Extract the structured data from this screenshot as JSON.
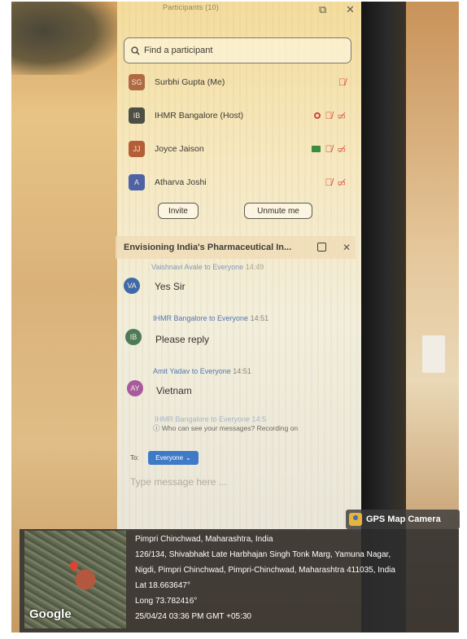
{
  "participants_panel": {
    "title": "Participants (10)",
    "search_placeholder": "Find a participant",
    "participants": [
      {
        "initials": "SG",
        "name": "Surbhi Gupta (Me)",
        "color": "#b06a43"
      },
      {
        "initials": "IB",
        "name": "IHMR Bangalore (Host)",
        "color": "#4b4f45"
      },
      {
        "initials": "JJ",
        "name": "Joyce Jaison",
        "color": "#b55d36"
      },
      {
        "initials": "A",
        "name": "Atharva Joshi",
        "color": "#4d63a6"
      }
    ],
    "invite_label": "Invite",
    "unmute_label": "Unmute me"
  },
  "chat_panel": {
    "title": "Envisioning India's Pharmaceutical In...",
    "messages": [
      {
        "sender": "Vaishnavi Avale to Everyone",
        "time": "14:49",
        "initials": "VA",
        "color": "#3f6aa8",
        "text": "Yes Sir"
      },
      {
        "sender": "IHMR Bangalore to Everyone",
        "time": "14:51",
        "initials": "IB",
        "color": "#4e7a5a",
        "text": "Please reply"
      },
      {
        "sender": "Amit Yadav to Everyone",
        "time": "14:51",
        "initials": "AY",
        "color": "#a85a9e",
        "text": "Vietnam"
      }
    ],
    "partial_sender": "IHMR Bangalore to Everyone 14:5",
    "visibility_hint": "Who can see your messages? Recording on",
    "to_label": "To:",
    "recipient": "Everyone",
    "input_placeholder": "Type message here ..."
  },
  "gps_overlay": {
    "brand": "GPS Map Camera",
    "map_label": "Google",
    "lines": [
      "Pimpri Chinchwad, Maharashtra, India",
      "126/134, Shivabhakt Late Harbhajan Singh Tonk Marg, Yamuna Nagar,",
      "Nigdi, Pimpri Chinchwad, Pimpri-Chinchwad, Maharashtra 411035, India",
      "Lat 18.663647°",
      "Long 73.782416°",
      "25/04/24 03:36 PM GMT +05:30"
    ]
  },
  "colors": {
    "accent_blue": "#3f7ac6",
    "muted_red": "#d7493d"
  }
}
